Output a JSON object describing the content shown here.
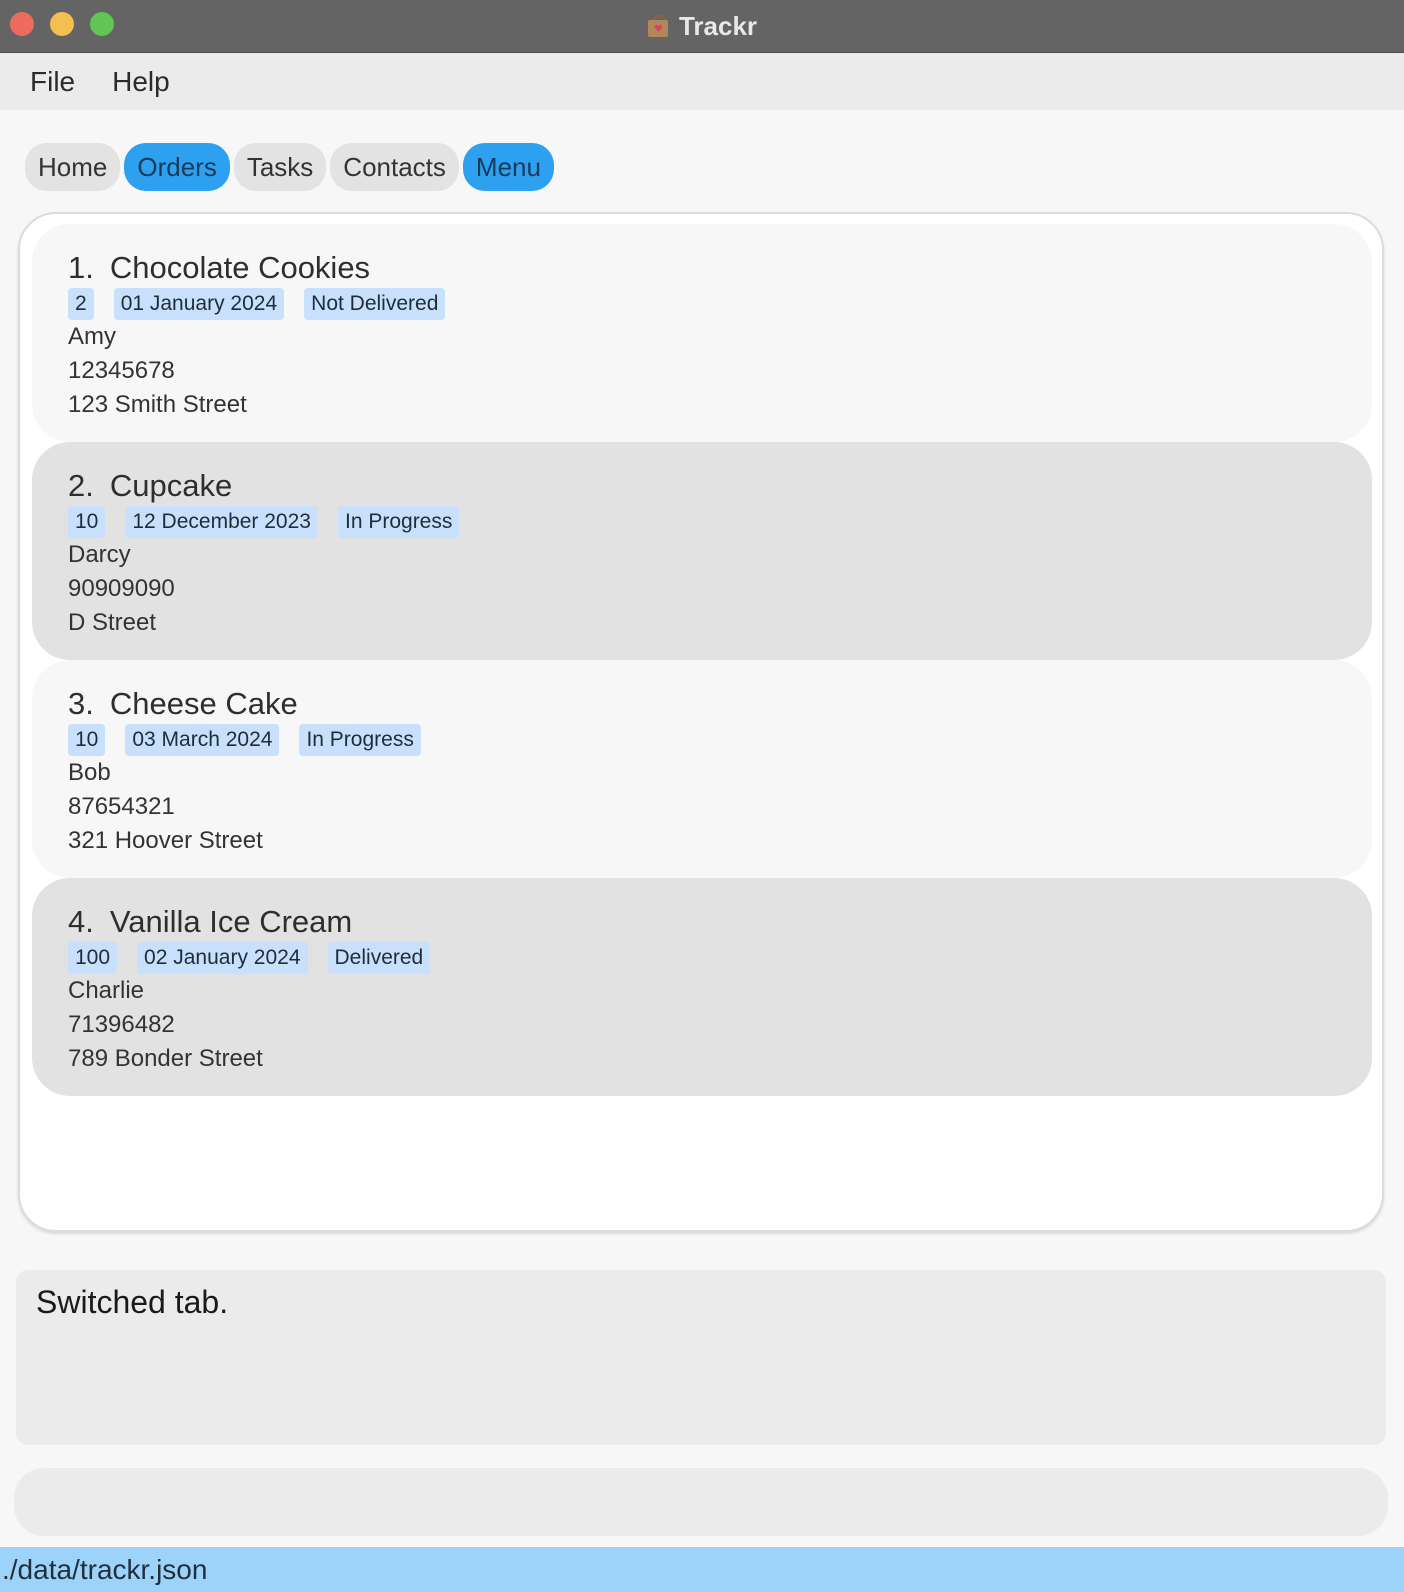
{
  "window": {
    "title": "Trackr",
    "icon": "shopping-bag-heart-icon"
  },
  "menubar": {
    "items": [
      {
        "label": "File"
      },
      {
        "label": "Help"
      }
    ]
  },
  "tabs": {
    "items": [
      {
        "label": "Home",
        "active": false
      },
      {
        "label": "Orders",
        "active": true
      },
      {
        "label": "Tasks",
        "active": false
      },
      {
        "label": "Contacts",
        "active": false
      },
      {
        "label": "Menu",
        "active": true
      }
    ],
    "accent_color": "#2da1ef"
  },
  "orders": [
    {
      "index": "1.",
      "name": "Chocolate Cookies",
      "quantity": "2",
      "date": "01 January 2024",
      "status": "Not Delivered",
      "customer": "Amy",
      "phone": "12345678",
      "address": "123 Smith Street"
    },
    {
      "index": "2.",
      "name": "Cupcake",
      "quantity": "10",
      "date": "12 December 2023",
      "status": "In Progress",
      "customer": "Darcy",
      "phone": "90909090",
      "address": "D Street"
    },
    {
      "index": "3.",
      "name": "Cheese Cake",
      "quantity": "10",
      "date": "03 March 2024",
      "status": "In Progress",
      "customer": "Bob",
      "phone": "87654321",
      "address": "321 Hoover Street"
    },
    {
      "index": "4.",
      "name": "Vanilla Ice Cream",
      "quantity": "100",
      "date": "02 January 2024",
      "status": "Delivered",
      "customer": "Charlie",
      "phone": "71396482",
      "address": "789 Bonder Street"
    }
  ],
  "result": {
    "message": "Switched tab."
  },
  "command": {
    "value": ""
  },
  "statusbar": {
    "path": "./data/trackr.json",
    "color": "#9dd3f8"
  }
}
